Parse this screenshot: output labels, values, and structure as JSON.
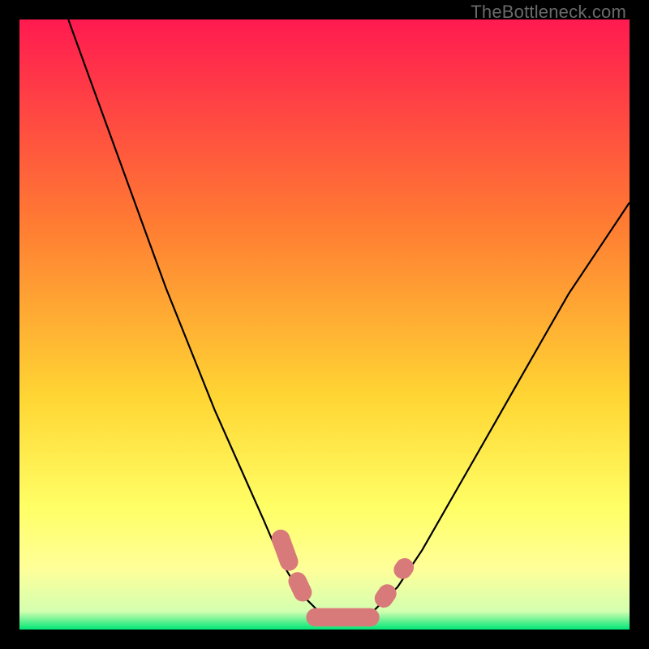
{
  "watermark": "TheBottleneck.com",
  "chart_data": {
    "type": "line",
    "title": "",
    "xlabel": "",
    "ylabel": "",
    "xlim": [
      0,
      100
    ],
    "ylim": [
      0,
      100
    ],
    "grid": false,
    "background_gradient": {
      "top_color": "#ff1a50",
      "mid_color_1": "#ff7a33",
      "mid_color_2": "#ffd633",
      "lower_color": "#ffff99",
      "bottom_color": "#00e676"
    },
    "series": [
      {
        "name": "bottleneck-curve",
        "color": "#000000",
        "x": [
          8,
          12,
          16,
          20,
          24,
          28,
          32,
          36,
          40,
          43,
          46,
          49,
          52,
          55,
          58,
          62,
          66,
          70,
          74,
          78,
          82,
          86,
          90,
          94,
          98,
          100
        ],
        "y": [
          100,
          89,
          78,
          67,
          56,
          46,
          36,
          27,
          18,
          11,
          6,
          3,
          1.5,
          1.5,
          3,
          7,
          13,
          20,
          27,
          34,
          41,
          48,
          55,
          61,
          67,
          70
        ]
      }
    ],
    "annotations": [
      {
        "name": "marker-pill-left",
        "shape": "capsule",
        "color": "#d97a7a",
        "x": 43.5,
        "y": 13,
        "width": 3,
        "length": 7,
        "rotation_deg": 70
      },
      {
        "name": "marker-dot-left-mid",
        "shape": "capsule",
        "color": "#d97a7a",
        "x": 46,
        "y": 7,
        "width": 3,
        "length": 5,
        "rotation_deg": 65
      },
      {
        "name": "marker-pill-bottom",
        "shape": "capsule",
        "color": "#d97a7a",
        "x": 53,
        "y": 2,
        "width": 3,
        "length": 12,
        "rotation_deg": 0
      },
      {
        "name": "marker-dot-right-mid",
        "shape": "capsule",
        "color": "#d97a7a",
        "x": 60,
        "y": 5.5,
        "width": 3,
        "length": 4,
        "rotation_deg": -55
      },
      {
        "name": "marker-dot-right",
        "shape": "capsule",
        "color": "#d97a7a",
        "x": 63,
        "y": 10,
        "width": 3,
        "length": 3.5,
        "rotation_deg": -55
      }
    ]
  }
}
